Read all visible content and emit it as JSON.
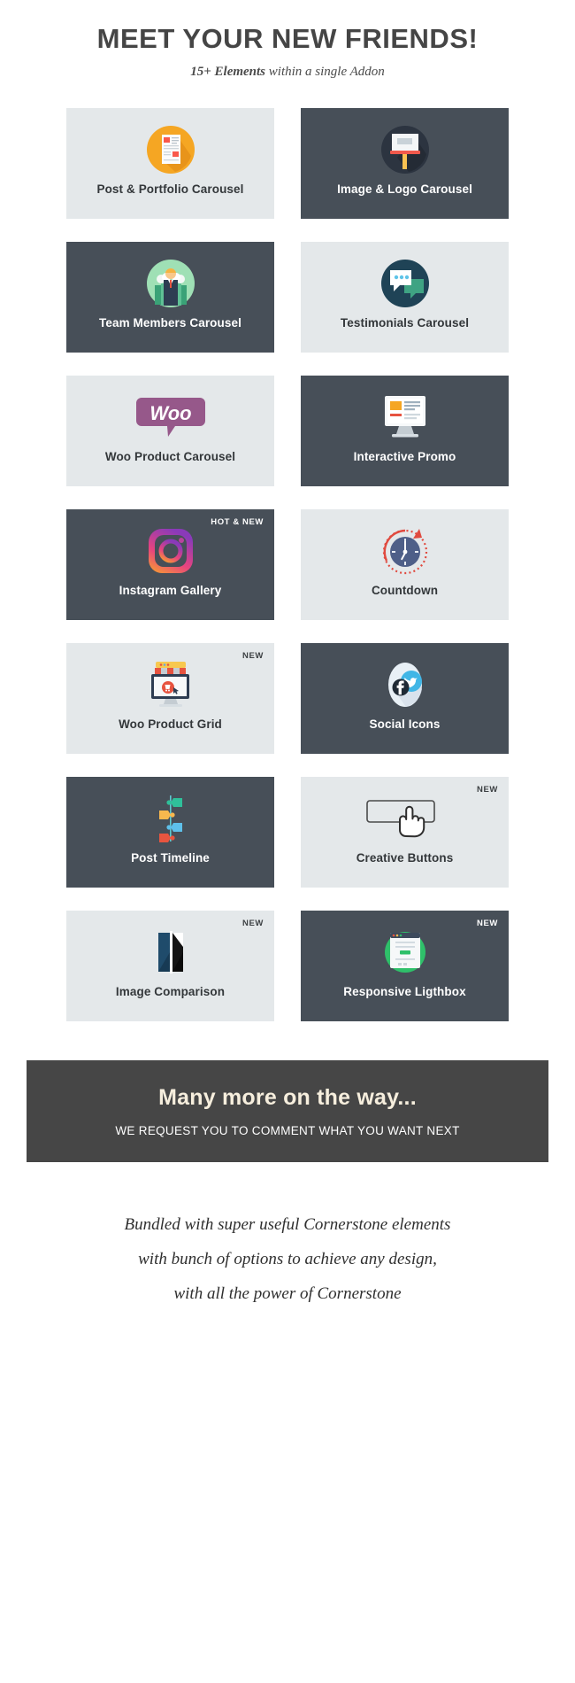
{
  "header": {
    "title": "MEET YOUR NEW FRIENDS!",
    "subtitle_strong": "15+ Elements",
    "subtitle_rest": " within a single Addon"
  },
  "cards": [
    {
      "label": "Post & Portfolio Carousel",
      "theme": "light",
      "badge": "",
      "icon": "post-portfolio-icon"
    },
    {
      "label": "Image & Logo Carousel",
      "theme": "dark",
      "badge": "",
      "icon": "image-logo-icon"
    },
    {
      "label": "Team Members Carousel",
      "theme": "dark",
      "badge": "",
      "icon": "team-members-icon"
    },
    {
      "label": "Testimonials Carousel",
      "theme": "light",
      "badge": "",
      "icon": "testimonials-icon"
    },
    {
      "label": "Woo Product Carousel",
      "theme": "light",
      "badge": "",
      "icon": "woo-logo-icon"
    },
    {
      "label": "Interactive Promo",
      "theme": "dark",
      "badge": "",
      "icon": "interactive-promo-icon"
    },
    {
      "label": "Instagram Gallery",
      "theme": "dark",
      "badge": "HOT & NEW",
      "icon": "instagram-icon"
    },
    {
      "label": "Countdown",
      "theme": "light",
      "badge": "",
      "icon": "countdown-clock-icon"
    },
    {
      "label": "Woo Product Grid",
      "theme": "light",
      "badge": "NEW",
      "icon": "woo-product-grid-icon"
    },
    {
      "label": "Social Icons",
      "theme": "dark",
      "badge": "",
      "icon": "social-icons-icon"
    },
    {
      "label": "Post Timeline",
      "theme": "dark",
      "badge": "",
      "icon": "post-timeline-icon"
    },
    {
      "label": "Creative Buttons",
      "theme": "light",
      "badge": "NEW",
      "icon": "creative-buttons-icon"
    },
    {
      "label": "Image Comparison",
      "theme": "light",
      "badge": "NEW",
      "icon": "image-comparison-icon"
    },
    {
      "label": "Responsive Ligthbox",
      "theme": "dark",
      "badge": "NEW",
      "icon": "responsive-lightbox-icon"
    }
  ],
  "banner": {
    "title": "Many more on the way...",
    "subtitle": "WE REQUEST YOU TO COMMENT WHAT YOU WANT NEXT"
  },
  "closing": {
    "line1": "Bundled with super useful Cornerstone elements",
    "line2": "with bunch of options to achieve any design,",
    "line3": "with all the power of Cornerstone"
  },
  "colors": {
    "card_light": "#e4e8ea",
    "card_dark": "#474f58",
    "banner_bg": "#464646",
    "banner_title": "#f6eedd",
    "woo_purple": "#96588a",
    "accent_orange": "#f5a623",
    "accent_green": "#2fb573",
    "accent_red": "#e84c3d"
  }
}
